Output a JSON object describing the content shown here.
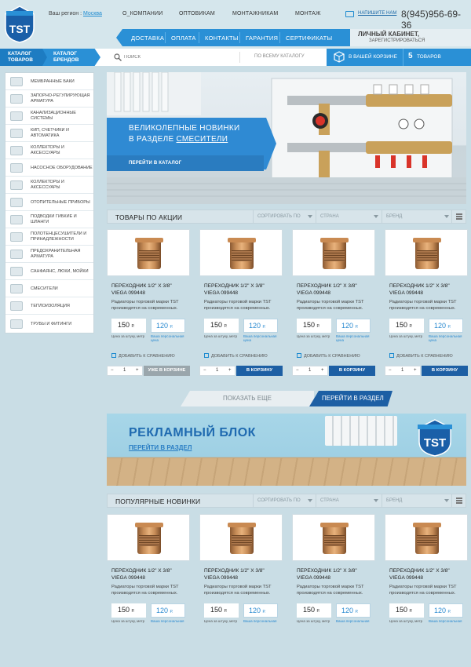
{
  "header": {
    "region_label": "Ваш регион :",
    "region_value": "Москва",
    "top_nav": [
      "О_КОМПАНИИ",
      "ОПТОВИКАМ",
      "МОНТАЖНИКАМ",
      "МОНТАЖ"
    ],
    "write_us": "НАПИШИТЕ НАМ",
    "phone": "8(945)956-69-36",
    "logo_text": "TST"
  },
  "main_nav": [
    "ДОСТАВКА",
    "ОПЛАТА",
    "КОНТАКТЫ",
    "ГАРАНТИЯ",
    "СЕРТИФИКАТЫ"
  ],
  "cabinet": {
    "title": "ЛИЧНЫЙ КАБИНЕТ,",
    "subtitle": "ЗАРЕГИСТРИРОВАТЬСЯ"
  },
  "catalog_bar": {
    "tab_goods": [
      "КАТАЛОГ",
      "ТОВАРОВ"
    ],
    "tab_brands": [
      "КАТАЛОГ",
      "БРЕНДОВ"
    ],
    "search_placeholder": "ПОИСК",
    "search_scope": "ПО ВСЕМУ КАТАЛОГУ",
    "cart_label": "В ВАШЕЙ КОРЗИНЕ",
    "cart_count": "5",
    "cart_unit": "ТОВАРОВ"
  },
  "sidebar": [
    "МЕМБРАННЫЕ БАКИ",
    "ЗАПОРНО-РЕГУЛИРУЮЩАЯ АРМАТУРА",
    "КАНАЛИЗАЦИОННЫЕ СИСТЕМЫ",
    "КИП, СЧЕТЧИКИ И АВТОМАТИКА",
    "КОЛЛЕКТОРЫ И АКСЕССУАРЫ",
    "НАСОСНОЕ ОБОРУДОВАНИЕ",
    "КОЛЛЕКТОРЫ И АКСЕССУАРЫ",
    "ОТОПИТЕЛЬНЫЕ ПРИБОРЫ",
    "ПОДВОДКИ ГИБКИЕ И ШЛАНГИ",
    "ПОЛОТЕНЦЕСУШИТЕЛИ И ПРИНАДЛЕЖНОСТИ",
    "ПРЕДОХРАНИТЕЛЬНАЯ АРМАТУРА",
    "САНФАЯНС, ЛЮКИ, МОЙКИ",
    "СМЕСИТЕЛИ",
    "ТЕПЛОИЗОЛЯЦИЯ",
    "ТРУБЫ И ФИТИНГИ"
  ],
  "banner": {
    "line1": "ВЕЛИКОЛЕПНЫЕ НОВИНКИ",
    "line2_prefix": "В РАЗДЕЛЕ",
    "line2_link": "СМЕСИТЕЛИ",
    "link": "ПЕРЕЙТИ В КАТАЛОГ"
  },
  "section_promo": {
    "title": "ТОВАРЫ ПО АКЦИИ",
    "sort": "СОРТИРОВАТЬ ПО",
    "country": "СТРАНА",
    "brand": "БРЕНД"
  },
  "section_new": {
    "title": "ПОПУЛЯРНЫЕ НОВИНКИ",
    "sort": "СОРТИРОВАТЬ ПО",
    "country": "СТРАНА",
    "brand": "БРЕНД"
  },
  "product": {
    "name_line1": "ПЕРЕХОДНИК 1/2\" X 3/8\"",
    "name_line2": "VIEGA 099448",
    "desc_line1": "Радиаторы торговой марки TST",
    "desc_line2": "производятся на современных.",
    "price": "150",
    "price_personal": "120",
    "currency": "Р.",
    "price_label": "Цена за штуку, метр",
    "personal_label_1": "Ваша персональная",
    "personal_label_2": "цена",
    "compare": "ДОБАВИТЬ К СРАВНЕНИЮ",
    "qty": "1",
    "buy": "В КОРЗИНУ",
    "in_cart": "УЖЕ В КОРЗИНЕ"
  },
  "show_more": "ПОКАЗАТЬ ЕЩЕ",
  "goto_section": "ПЕРЕЙТИ В РАЗДЕЛ",
  "ad": {
    "title": "РЕКЛАМНЫЙ БЛОК",
    "link": "ПЕРЕЙТИ В РАЗДЕЛ"
  },
  "colors": {
    "accent": "#2a90d6",
    "dark_accent": "#1d5fa4",
    "background": "#c9dde5"
  }
}
